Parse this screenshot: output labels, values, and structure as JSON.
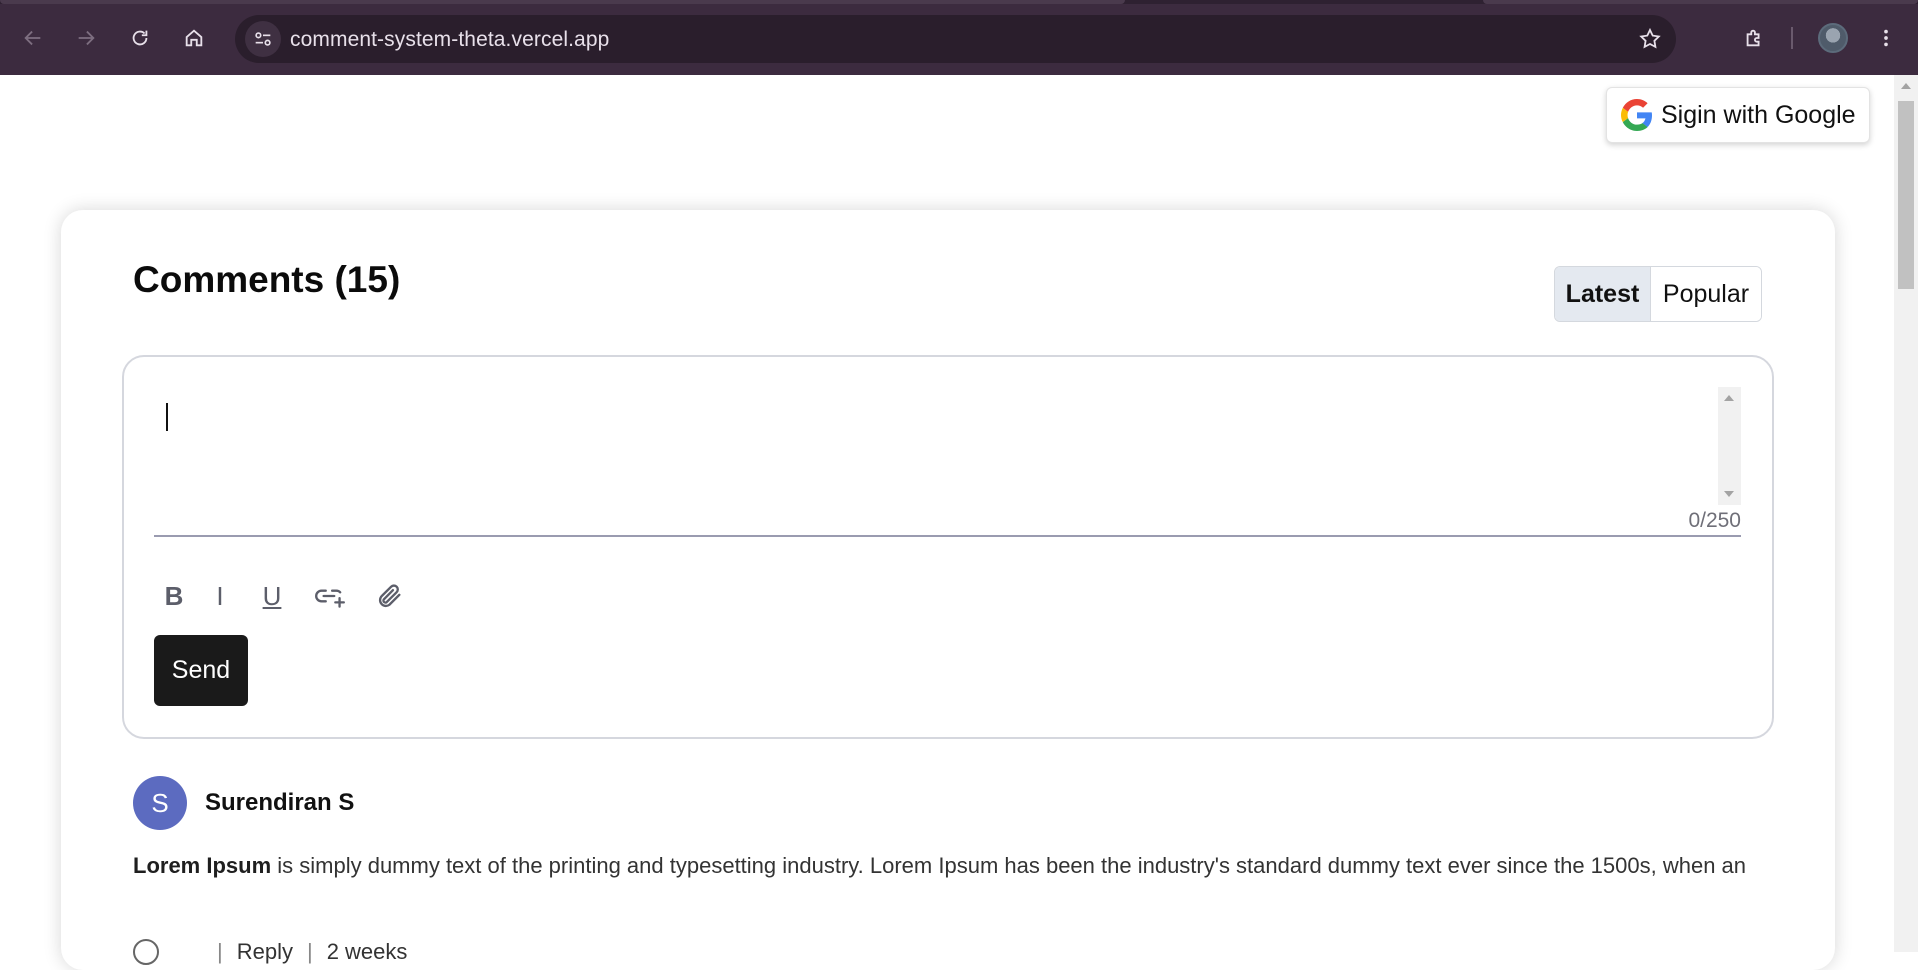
{
  "browser": {
    "url": "comment-system-theta.vercel.app"
  },
  "auth": {
    "signin_label": "Sigin with Google"
  },
  "comments": {
    "title": "Comments (15)",
    "sort_options": [
      "Latest",
      "Popular"
    ],
    "active_sort": "Latest"
  },
  "composer": {
    "value": "",
    "counter": "0/250",
    "toolbar": {
      "bold_label": "B",
      "italic_label": "I",
      "underline_label": "U"
    },
    "send_label": "Send"
  },
  "comment_list": [
    {
      "avatar_initial": "S",
      "author": "Surendiran S",
      "text_bold": "Lorem Ipsum",
      "text": " is simply dummy text of the printing and typesetting industry. Lorem Ipsum has been the industry's standard dummy text ever since the 1500s, when an",
      "reply_label": "Reply",
      "time": "2 weeks"
    }
  ],
  "colors": {
    "chrome_bg": "#3c2b3f",
    "omnibox_bg": "#2a1e2c",
    "send_bg": "#1a1a1a",
    "avatar_bg": "#5c6bc0",
    "active_sort_bg": "#e4e9f0"
  }
}
